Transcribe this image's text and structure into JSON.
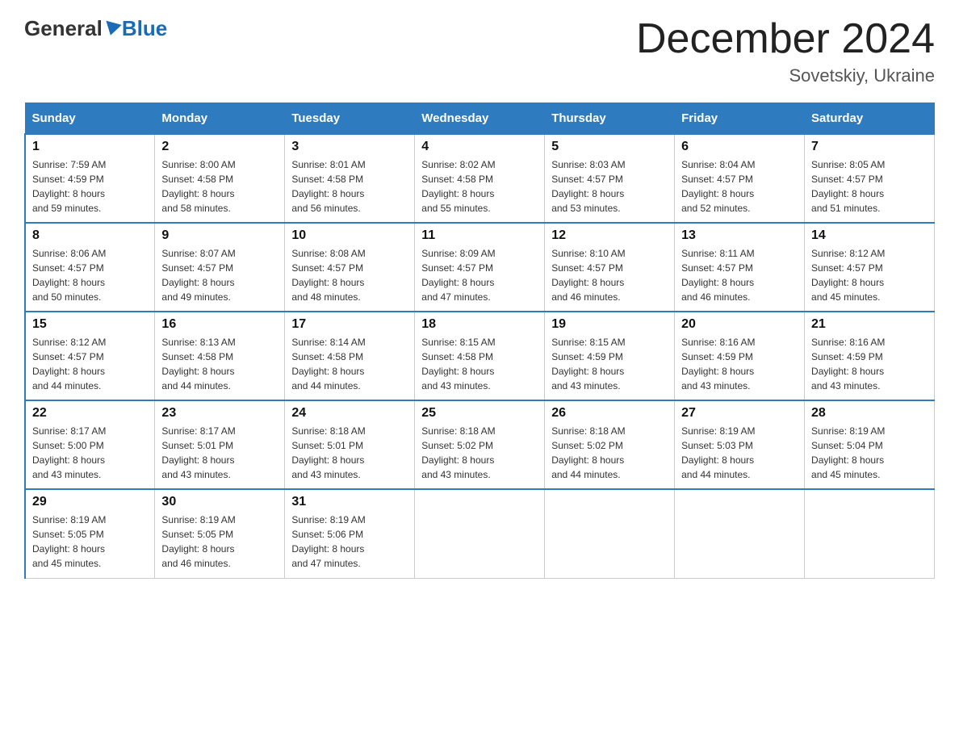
{
  "logo": {
    "general": "General",
    "blue": "Blue"
  },
  "header": {
    "title": "December 2024",
    "subtitle": "Sovetskiy, Ukraine"
  },
  "days_of_week": [
    "Sunday",
    "Monday",
    "Tuesday",
    "Wednesday",
    "Thursday",
    "Friday",
    "Saturday"
  ],
  "weeks": [
    [
      {
        "day": "1",
        "sunrise": "Sunrise: 7:59 AM",
        "sunset": "Sunset: 4:59 PM",
        "daylight": "Daylight: 8 hours",
        "minutes": "and 59 minutes."
      },
      {
        "day": "2",
        "sunrise": "Sunrise: 8:00 AM",
        "sunset": "Sunset: 4:58 PM",
        "daylight": "Daylight: 8 hours",
        "minutes": "and 58 minutes."
      },
      {
        "day": "3",
        "sunrise": "Sunrise: 8:01 AM",
        "sunset": "Sunset: 4:58 PM",
        "daylight": "Daylight: 8 hours",
        "minutes": "and 56 minutes."
      },
      {
        "day": "4",
        "sunrise": "Sunrise: 8:02 AM",
        "sunset": "Sunset: 4:58 PM",
        "daylight": "Daylight: 8 hours",
        "minutes": "and 55 minutes."
      },
      {
        "day": "5",
        "sunrise": "Sunrise: 8:03 AM",
        "sunset": "Sunset: 4:57 PM",
        "daylight": "Daylight: 8 hours",
        "minutes": "and 53 minutes."
      },
      {
        "day": "6",
        "sunrise": "Sunrise: 8:04 AM",
        "sunset": "Sunset: 4:57 PM",
        "daylight": "Daylight: 8 hours",
        "minutes": "and 52 minutes."
      },
      {
        "day": "7",
        "sunrise": "Sunrise: 8:05 AM",
        "sunset": "Sunset: 4:57 PM",
        "daylight": "Daylight: 8 hours",
        "minutes": "and 51 minutes."
      }
    ],
    [
      {
        "day": "8",
        "sunrise": "Sunrise: 8:06 AM",
        "sunset": "Sunset: 4:57 PM",
        "daylight": "Daylight: 8 hours",
        "minutes": "and 50 minutes."
      },
      {
        "day": "9",
        "sunrise": "Sunrise: 8:07 AM",
        "sunset": "Sunset: 4:57 PM",
        "daylight": "Daylight: 8 hours",
        "minutes": "and 49 minutes."
      },
      {
        "day": "10",
        "sunrise": "Sunrise: 8:08 AM",
        "sunset": "Sunset: 4:57 PM",
        "daylight": "Daylight: 8 hours",
        "minutes": "and 48 minutes."
      },
      {
        "day": "11",
        "sunrise": "Sunrise: 8:09 AM",
        "sunset": "Sunset: 4:57 PM",
        "daylight": "Daylight: 8 hours",
        "minutes": "and 47 minutes."
      },
      {
        "day": "12",
        "sunrise": "Sunrise: 8:10 AM",
        "sunset": "Sunset: 4:57 PM",
        "daylight": "Daylight: 8 hours",
        "minutes": "and 46 minutes."
      },
      {
        "day": "13",
        "sunrise": "Sunrise: 8:11 AM",
        "sunset": "Sunset: 4:57 PM",
        "daylight": "Daylight: 8 hours",
        "minutes": "and 46 minutes."
      },
      {
        "day": "14",
        "sunrise": "Sunrise: 8:12 AM",
        "sunset": "Sunset: 4:57 PM",
        "daylight": "Daylight: 8 hours",
        "minutes": "and 45 minutes."
      }
    ],
    [
      {
        "day": "15",
        "sunrise": "Sunrise: 8:12 AM",
        "sunset": "Sunset: 4:57 PM",
        "daylight": "Daylight: 8 hours",
        "minutes": "and 44 minutes."
      },
      {
        "day": "16",
        "sunrise": "Sunrise: 8:13 AM",
        "sunset": "Sunset: 4:58 PM",
        "daylight": "Daylight: 8 hours",
        "minutes": "and 44 minutes."
      },
      {
        "day": "17",
        "sunrise": "Sunrise: 8:14 AM",
        "sunset": "Sunset: 4:58 PM",
        "daylight": "Daylight: 8 hours",
        "minutes": "and 44 minutes."
      },
      {
        "day": "18",
        "sunrise": "Sunrise: 8:15 AM",
        "sunset": "Sunset: 4:58 PM",
        "daylight": "Daylight: 8 hours",
        "minutes": "and 43 minutes."
      },
      {
        "day": "19",
        "sunrise": "Sunrise: 8:15 AM",
        "sunset": "Sunset: 4:59 PM",
        "daylight": "Daylight: 8 hours",
        "minutes": "and 43 minutes."
      },
      {
        "day": "20",
        "sunrise": "Sunrise: 8:16 AM",
        "sunset": "Sunset: 4:59 PM",
        "daylight": "Daylight: 8 hours",
        "minutes": "and 43 minutes."
      },
      {
        "day": "21",
        "sunrise": "Sunrise: 8:16 AM",
        "sunset": "Sunset: 4:59 PM",
        "daylight": "Daylight: 8 hours",
        "minutes": "and 43 minutes."
      }
    ],
    [
      {
        "day": "22",
        "sunrise": "Sunrise: 8:17 AM",
        "sunset": "Sunset: 5:00 PM",
        "daylight": "Daylight: 8 hours",
        "minutes": "and 43 minutes."
      },
      {
        "day": "23",
        "sunrise": "Sunrise: 8:17 AM",
        "sunset": "Sunset: 5:01 PM",
        "daylight": "Daylight: 8 hours",
        "minutes": "and 43 minutes."
      },
      {
        "day": "24",
        "sunrise": "Sunrise: 8:18 AM",
        "sunset": "Sunset: 5:01 PM",
        "daylight": "Daylight: 8 hours",
        "minutes": "and 43 minutes."
      },
      {
        "day": "25",
        "sunrise": "Sunrise: 8:18 AM",
        "sunset": "Sunset: 5:02 PM",
        "daylight": "Daylight: 8 hours",
        "minutes": "and 43 minutes."
      },
      {
        "day": "26",
        "sunrise": "Sunrise: 8:18 AM",
        "sunset": "Sunset: 5:02 PM",
        "daylight": "Daylight: 8 hours",
        "minutes": "and 44 minutes."
      },
      {
        "day": "27",
        "sunrise": "Sunrise: 8:19 AM",
        "sunset": "Sunset: 5:03 PM",
        "daylight": "Daylight: 8 hours",
        "minutes": "and 44 minutes."
      },
      {
        "day": "28",
        "sunrise": "Sunrise: 8:19 AM",
        "sunset": "Sunset: 5:04 PM",
        "daylight": "Daylight: 8 hours",
        "minutes": "and 45 minutes."
      }
    ],
    [
      {
        "day": "29",
        "sunrise": "Sunrise: 8:19 AM",
        "sunset": "Sunset: 5:05 PM",
        "daylight": "Daylight: 8 hours",
        "minutes": "and 45 minutes."
      },
      {
        "day": "30",
        "sunrise": "Sunrise: 8:19 AM",
        "sunset": "Sunset: 5:05 PM",
        "daylight": "Daylight: 8 hours",
        "minutes": "and 46 minutes."
      },
      {
        "day": "31",
        "sunrise": "Sunrise: 8:19 AM",
        "sunset": "Sunset: 5:06 PM",
        "daylight": "Daylight: 8 hours",
        "minutes": "and 47 minutes."
      },
      null,
      null,
      null,
      null
    ]
  ]
}
